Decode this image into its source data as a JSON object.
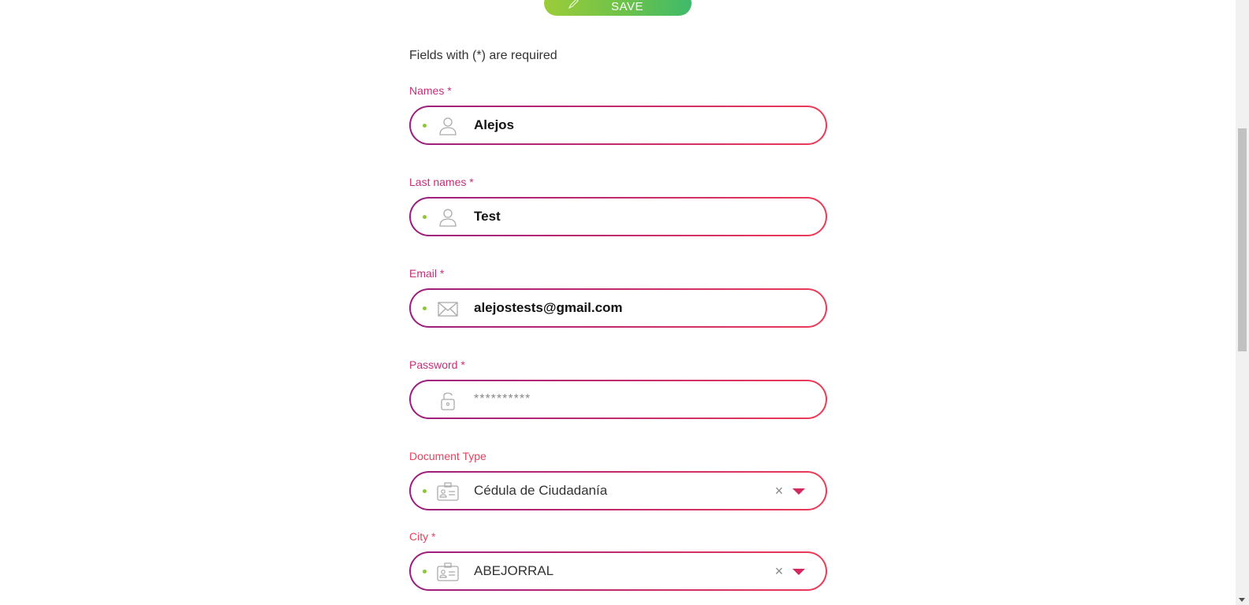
{
  "toolbar": {
    "save_label": "SAVE"
  },
  "form": {
    "required_note": "Fields with (*) are required",
    "names": {
      "label": "Names *",
      "value": "Alejos",
      "icon": "user-icon"
    },
    "last_names": {
      "label": "Last names *",
      "value": "Test",
      "icon": "user-icon"
    },
    "email": {
      "label": "Email *",
      "value": "alejostests@gmail.com",
      "icon": "envelope-icon"
    },
    "password": {
      "label": "Password *",
      "placeholder": "**********",
      "icon": "lock-icon"
    },
    "document_type": {
      "label": "Document Type",
      "value": "Cédula de Ciudadanía",
      "clear": "×",
      "icon": "id-card-icon"
    },
    "city": {
      "label": "City *",
      "value": "ABEJORRAL",
      "clear": "×",
      "icon": "id-card-icon"
    }
  },
  "colors": {
    "label_magenta": "#c2307a",
    "label_coral": "#e2445f",
    "border_start": "#9b1f7e",
    "border_end": "#ee3a55",
    "dot_green": "#8cc63f",
    "save_green_start": "#9ccc3a",
    "save_green_end": "#3fba6b"
  }
}
